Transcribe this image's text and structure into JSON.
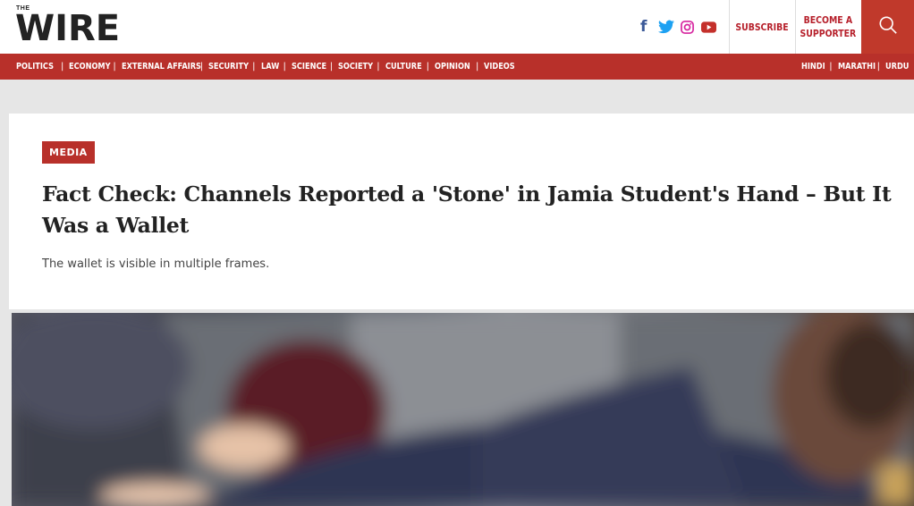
{
  "header": {
    "logo_small": "THE",
    "logo_main": "WIRE",
    "social": [
      "facebook-icon",
      "twitter-icon",
      "instagram-icon",
      "youtube-icon"
    ],
    "subscribe_label": "SUBSCRIBE",
    "become_line1": "BECOME A",
    "become_line2": "SUPPORTER"
  },
  "nav": {
    "left": [
      "POLITICS",
      "ECONOMY",
      "EXTERNAL AFFAIRS",
      "SECURITY",
      "LAW",
      "SCIENCE",
      "SOCIETY",
      "CULTURE",
      "OPINION",
      "VIDEOS"
    ],
    "right": [
      "HINDI",
      "MARATHI",
      "URDU"
    ]
  },
  "article": {
    "category": "MEDIA",
    "title": "Fact Check: Channels Reported a 'Stone' in Jamia Student's Hand – But It Was a Wallet",
    "subtitle": "The wallet is visible in multiple frames."
  },
  "colors": {
    "brand_red": "#b8302a",
    "search_red": "#c0392b",
    "page_bg": "#e6e6e6"
  }
}
